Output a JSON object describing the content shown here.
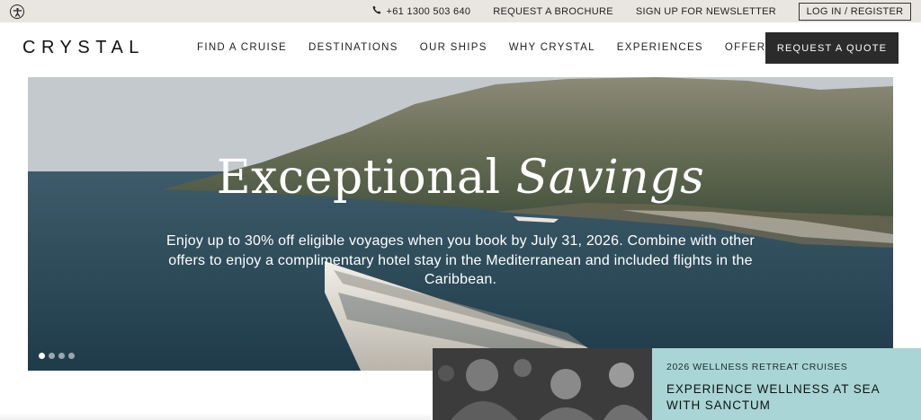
{
  "utility": {
    "accessibility_icon": "accessibility-icon",
    "phone_icon": "phone-icon",
    "phone": "+61 1300 503 640",
    "brochure": "REQUEST A BROCHURE",
    "newsletter": "SIGN UP FOR NEWSLETTER",
    "login": "LOG IN / REGISTER"
  },
  "nav": {
    "logo": "CRYSTAL",
    "items": [
      {
        "label": "FIND A CRUISE"
      },
      {
        "label": "DESTINATIONS"
      },
      {
        "label": "OUR SHIPS"
      },
      {
        "label": "WHY CRYSTAL"
      },
      {
        "label": "EXPERIENCES"
      },
      {
        "label": "OFFERS"
      }
    ],
    "cta": "REQUEST A QUOTE"
  },
  "hero": {
    "title_regular": "Exceptional",
    "title_italic": "Savings",
    "body": "Enjoy up to 30% off eligible voyages when you book by July 31, 2026. Combine with other offers to enjoy a complimentary hotel stay in the Mediterranean and included flights in the Caribbean.",
    "slide_count": 4,
    "active_slide": 1
  },
  "promo": {
    "eyebrow": "2026 WELLNESS RETREAT CRUISES",
    "title": "EXPERIENCE WELLNESS AT SEA WITH SANCTUM"
  },
  "colors": {
    "utility_bg": "#e9e6e1",
    "cta_bg": "#2b2b2b",
    "promo_bg": "#a9d5d6"
  }
}
